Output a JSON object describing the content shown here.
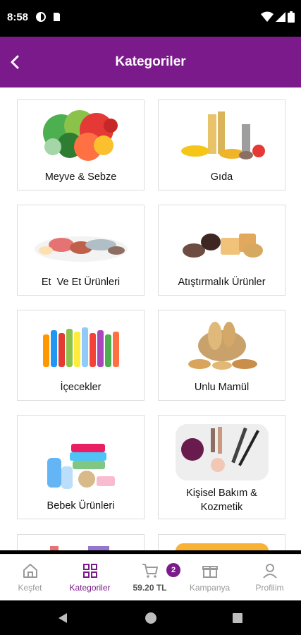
{
  "status_bar": {
    "time": "8:58"
  },
  "header": {
    "title": "Kategoriler"
  },
  "categories": [
    {
      "label": "Meyve & Sebze",
      "icon": "vegetables-image"
    },
    {
      "label": "Gıda",
      "icon": "pasta-groceries-image"
    },
    {
      "label": "Et  Ve Et Ürünleri",
      "icon": "meat-fish-image"
    },
    {
      "label": "Atıştırmalık Ürünler",
      "icon": "snacks-image"
    },
    {
      "label": "İçecekler",
      "icon": "drinks-bottles-image"
    },
    {
      "label": "Unlu Mamül",
      "icon": "bread-basket-image"
    },
    {
      "label": "Bebek Ürünleri",
      "icon": "baby-products-image"
    },
    {
      "label_line1": "Kişisel Bakım &",
      "label_line2": "Kozmetik",
      "icon": "cosmetics-image"
    }
  ],
  "bottom_nav": {
    "items": [
      {
        "label": "Keşfet",
        "icon": "home-icon"
      },
      {
        "label": "Kategoriler",
        "icon": "grid-icon",
        "active": true
      },
      {
        "label": "59.20 TL",
        "icon": "cart-icon"
      },
      {
        "label": "Kampanya",
        "icon": "gift-icon"
      },
      {
        "label": "Profilim",
        "icon": "user-icon"
      }
    ],
    "cart_badge": "2"
  },
  "colors": {
    "primary": "#7b1a8a",
    "inactive": "#9a9a9a"
  }
}
